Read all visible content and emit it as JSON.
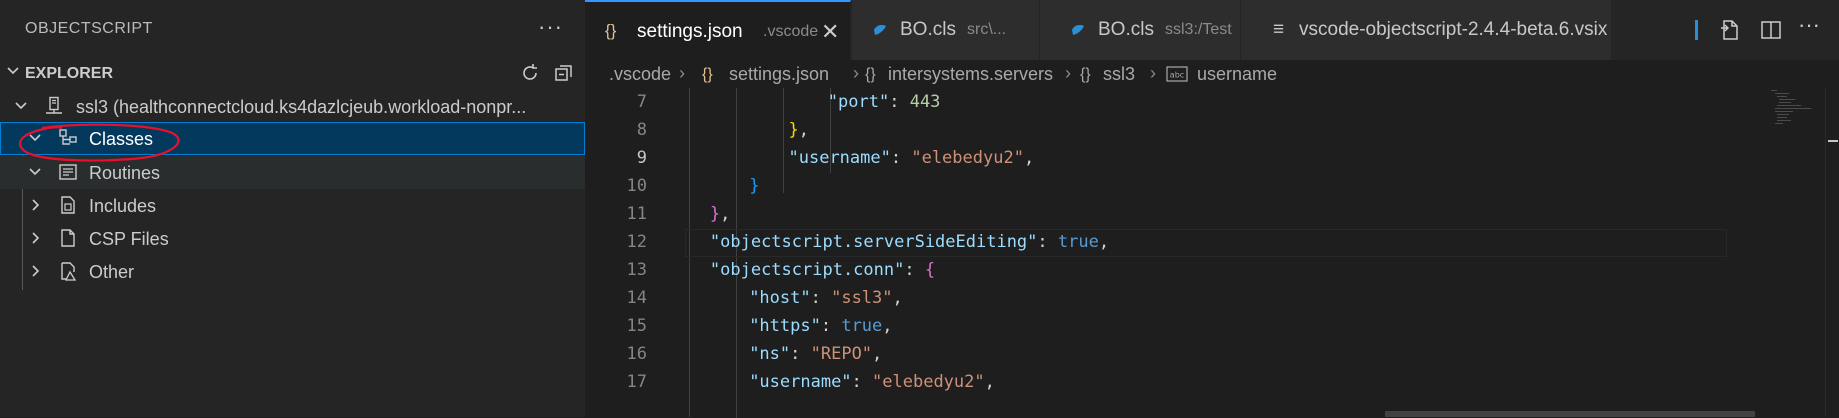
{
  "sidebar": {
    "title": "OBJECTSCRIPT",
    "more": "···",
    "explorer_label": "EXPLORER",
    "server": "ssl3 (healthconnectcloud.ks4dazlcjeub.workload-nonpr...",
    "items": [
      {
        "label": "Classes"
      },
      {
        "label": "Routines"
      },
      {
        "label": "Includes"
      },
      {
        "label": "CSP Files"
      },
      {
        "label": "Other"
      }
    ]
  },
  "tabs": [
    {
      "icon": "{}",
      "name": "settings.json",
      "desc": ".vscode",
      "close": "✕"
    },
    {
      "name": "BO.cls",
      "desc": "src\\..."
    },
    {
      "name": "BO.cls",
      "desc": "ssl3:/Test"
    },
    {
      "icon": "≡",
      "name": "vscode-objectscript-2.4.4-beta.6.vsix"
    }
  ],
  "breadcrumb": {
    "folder": ".vscode",
    "file": "settings.json",
    "obj1": "intersystems.servers",
    "obj2": "ssl3",
    "prop": "username",
    "brace_icon": "{}",
    "brace_icon_y": "{}"
  },
  "code": [
    {
      "n": "7",
      "t": [
        [
          "\"port\"",
          "k"
        ],
        [
          ": ",
          "p"
        ],
        [
          "443",
          "n"
        ]
      ]
    },
    {
      "n": "8",
      "t": [
        [
          "}",
          "br1"
        ],
        [
          ",",
          "p"
        ]
      ]
    },
    {
      "n": "9",
      "t": [
        [
          "\"username\"",
          "k"
        ],
        [
          ": ",
          "p"
        ],
        [
          "\"elebedyu2\"",
          "s"
        ],
        [
          ",",
          "p"
        ]
      ]
    },
    {
      "n": "10",
      "t": [
        [
          "}",
          "br3"
        ]
      ]
    },
    {
      "n": "11",
      "t": [
        [
          "}",
          "br2"
        ],
        [
          ",",
          "p"
        ]
      ]
    },
    {
      "n": "12",
      "t": [
        [
          "\"objectscript.serverSideEditing\"",
          "k"
        ],
        [
          ": ",
          "p"
        ],
        [
          "true",
          "b"
        ],
        [
          ",",
          "p"
        ]
      ]
    },
    {
      "n": "13",
      "t": [
        [
          "\"objectscript.conn\"",
          "k"
        ],
        [
          ": ",
          "p"
        ],
        [
          "{",
          "br2"
        ]
      ]
    },
    {
      "n": "14",
      "t": [
        [
          "\"host\"",
          "k"
        ],
        [
          ": ",
          "p"
        ],
        [
          "\"ssl3\"",
          "s"
        ],
        [
          ",",
          "p"
        ]
      ]
    },
    {
      "n": "15",
      "t": [
        [
          "\"https\"",
          "k"
        ],
        [
          ": ",
          "p"
        ],
        [
          "true",
          "b"
        ],
        [
          ",",
          "p"
        ]
      ]
    },
    {
      "n": "16",
      "t": [
        [
          "\"ns\"",
          "k"
        ],
        [
          ": ",
          "p"
        ],
        [
          "\"REPO\"",
          "s"
        ],
        [
          ",",
          "p"
        ]
      ]
    },
    {
      "n": "17",
      "t": [
        [
          "\"username\"",
          "k"
        ],
        [
          ": ",
          "p"
        ],
        [
          "\"elebedyu2\"",
          "s"
        ],
        [
          ",",
          "p"
        ]
      ]
    }
  ],
  "colors": {
    "accent": "#3794ff",
    "selection": "#04395e",
    "annotation": "#e8112d"
  }
}
